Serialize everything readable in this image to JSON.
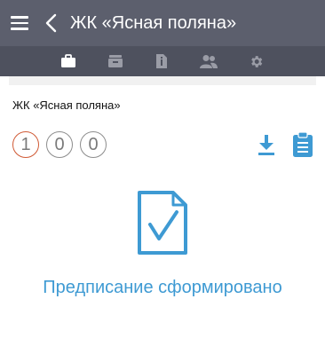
{
  "appbar": {
    "title": "ЖК «Ясная поляна»"
  },
  "tabs": [
    {
      "icon": "briefcase-icon",
      "active": true
    },
    {
      "icon": "archive-icon",
      "active": false
    },
    {
      "icon": "document-info-icon",
      "active": false
    },
    {
      "icon": "users-icon",
      "active": false
    },
    {
      "icon": "gear-icon",
      "active": false
    }
  ],
  "content": {
    "object_name": "ЖК «Ясная поляна»",
    "counters": [
      {
        "value": "1",
        "color": "#d05a35"
      },
      {
        "value": "0",
        "color": "#8d8d8d"
      },
      {
        "value": "0",
        "color": "#8d8d8d"
      }
    ],
    "status_text": "Предписание сформировано"
  },
  "colors": {
    "appbar": "#5c5f6d",
    "tabbar": "#4e515e",
    "accent": "#3e9ad3",
    "counter_alert": "#d05a35"
  }
}
